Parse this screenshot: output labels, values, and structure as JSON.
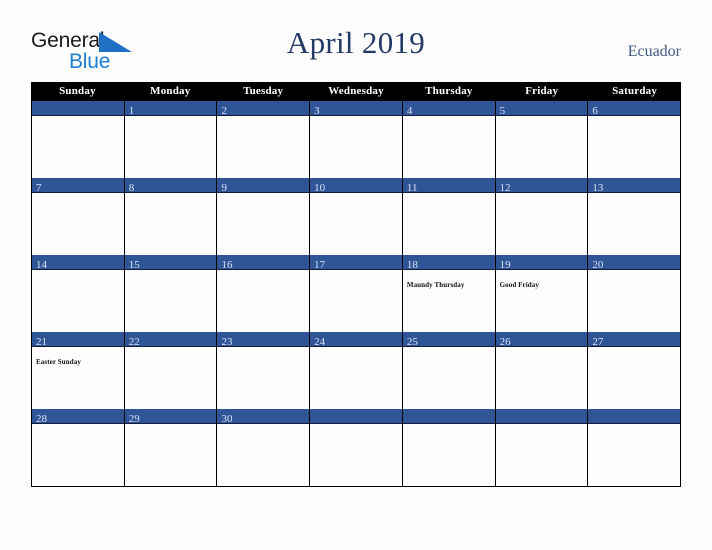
{
  "brand": {
    "name_part1": "General",
    "name_part2": "Blue",
    "triangle_color": "#1f6fc4",
    "blue_color": "#1f7ed0"
  },
  "header": {
    "title": "April 2019",
    "country": "Ecuador",
    "title_color": "#243a66",
    "country_color": "#415a86"
  },
  "calendar": {
    "month": "April",
    "year": "2019",
    "accent_color": "#2f5597",
    "header_bg": "#000000",
    "day_names": [
      "Sunday",
      "Monday",
      "Tuesday",
      "Wednesday",
      "Thursday",
      "Friday",
      "Saturday"
    ],
    "weeks": [
      [
        {
          "num": "",
          "event": ""
        },
        {
          "num": "1",
          "event": ""
        },
        {
          "num": "2",
          "event": ""
        },
        {
          "num": "3",
          "event": ""
        },
        {
          "num": "4",
          "event": ""
        },
        {
          "num": "5",
          "event": ""
        },
        {
          "num": "6",
          "event": ""
        }
      ],
      [
        {
          "num": "7",
          "event": ""
        },
        {
          "num": "8",
          "event": ""
        },
        {
          "num": "9",
          "event": ""
        },
        {
          "num": "10",
          "event": ""
        },
        {
          "num": "11",
          "event": ""
        },
        {
          "num": "12",
          "event": ""
        },
        {
          "num": "13",
          "event": ""
        }
      ],
      [
        {
          "num": "14",
          "event": ""
        },
        {
          "num": "15",
          "event": ""
        },
        {
          "num": "16",
          "event": ""
        },
        {
          "num": "17",
          "event": ""
        },
        {
          "num": "18",
          "event": "Maundy Thursday"
        },
        {
          "num": "19",
          "event": "Good Friday"
        },
        {
          "num": "20",
          "event": ""
        }
      ],
      [
        {
          "num": "21",
          "event": "Easter Sunday"
        },
        {
          "num": "22",
          "event": ""
        },
        {
          "num": "23",
          "event": ""
        },
        {
          "num": "24",
          "event": ""
        },
        {
          "num": "25",
          "event": ""
        },
        {
          "num": "26",
          "event": ""
        },
        {
          "num": "27",
          "event": ""
        }
      ],
      [
        {
          "num": "28",
          "event": ""
        },
        {
          "num": "29",
          "event": ""
        },
        {
          "num": "30",
          "event": ""
        },
        {
          "num": "",
          "event": ""
        },
        {
          "num": "",
          "event": ""
        },
        {
          "num": "",
          "event": ""
        },
        {
          "num": "",
          "event": ""
        }
      ]
    ]
  }
}
